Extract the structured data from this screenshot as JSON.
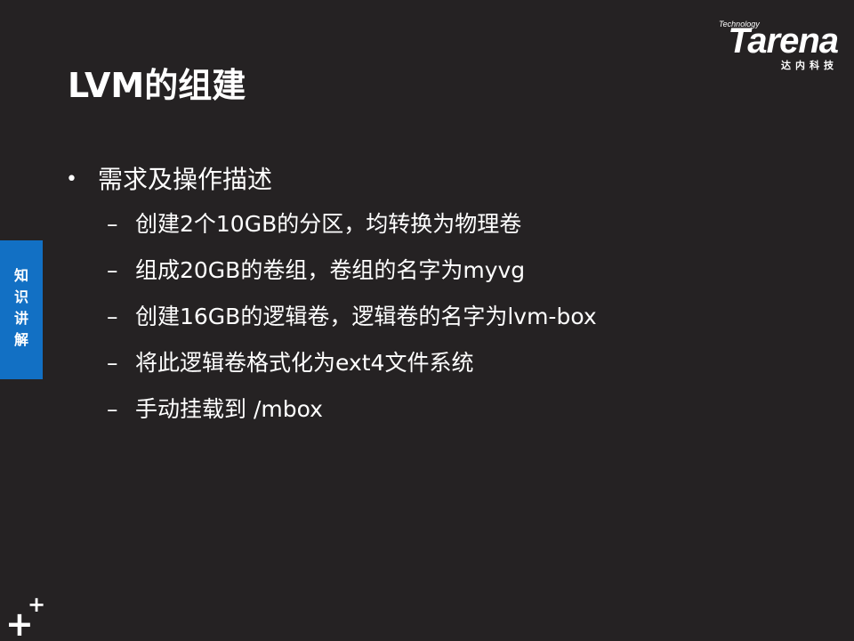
{
  "brand": {
    "tech_label": "Technology",
    "name": "Tarena",
    "subtitle": "达内科技"
  },
  "slide": {
    "title": "LVM的组建",
    "section_bullet": "•",
    "section_heading": "需求及操作描述",
    "items": [
      "创建2个10GB的分区，均转换为物理卷",
      "组成20GB的卷组，卷组的名字为myvg",
      "创建16GB的逻辑卷，逻辑卷的名字为lvm-box",
      "将此逻辑卷格式化为ext4文件系统",
      "手动挂载到 /mbox"
    ],
    "item_dash": "–"
  },
  "side_tab": {
    "label": "知识讲解"
  },
  "footer": {
    "plus_big": "+",
    "plus_small": "+"
  },
  "colors": {
    "background": "#252223",
    "accent_blue": "#1270c4",
    "text": "#ffffff"
  }
}
